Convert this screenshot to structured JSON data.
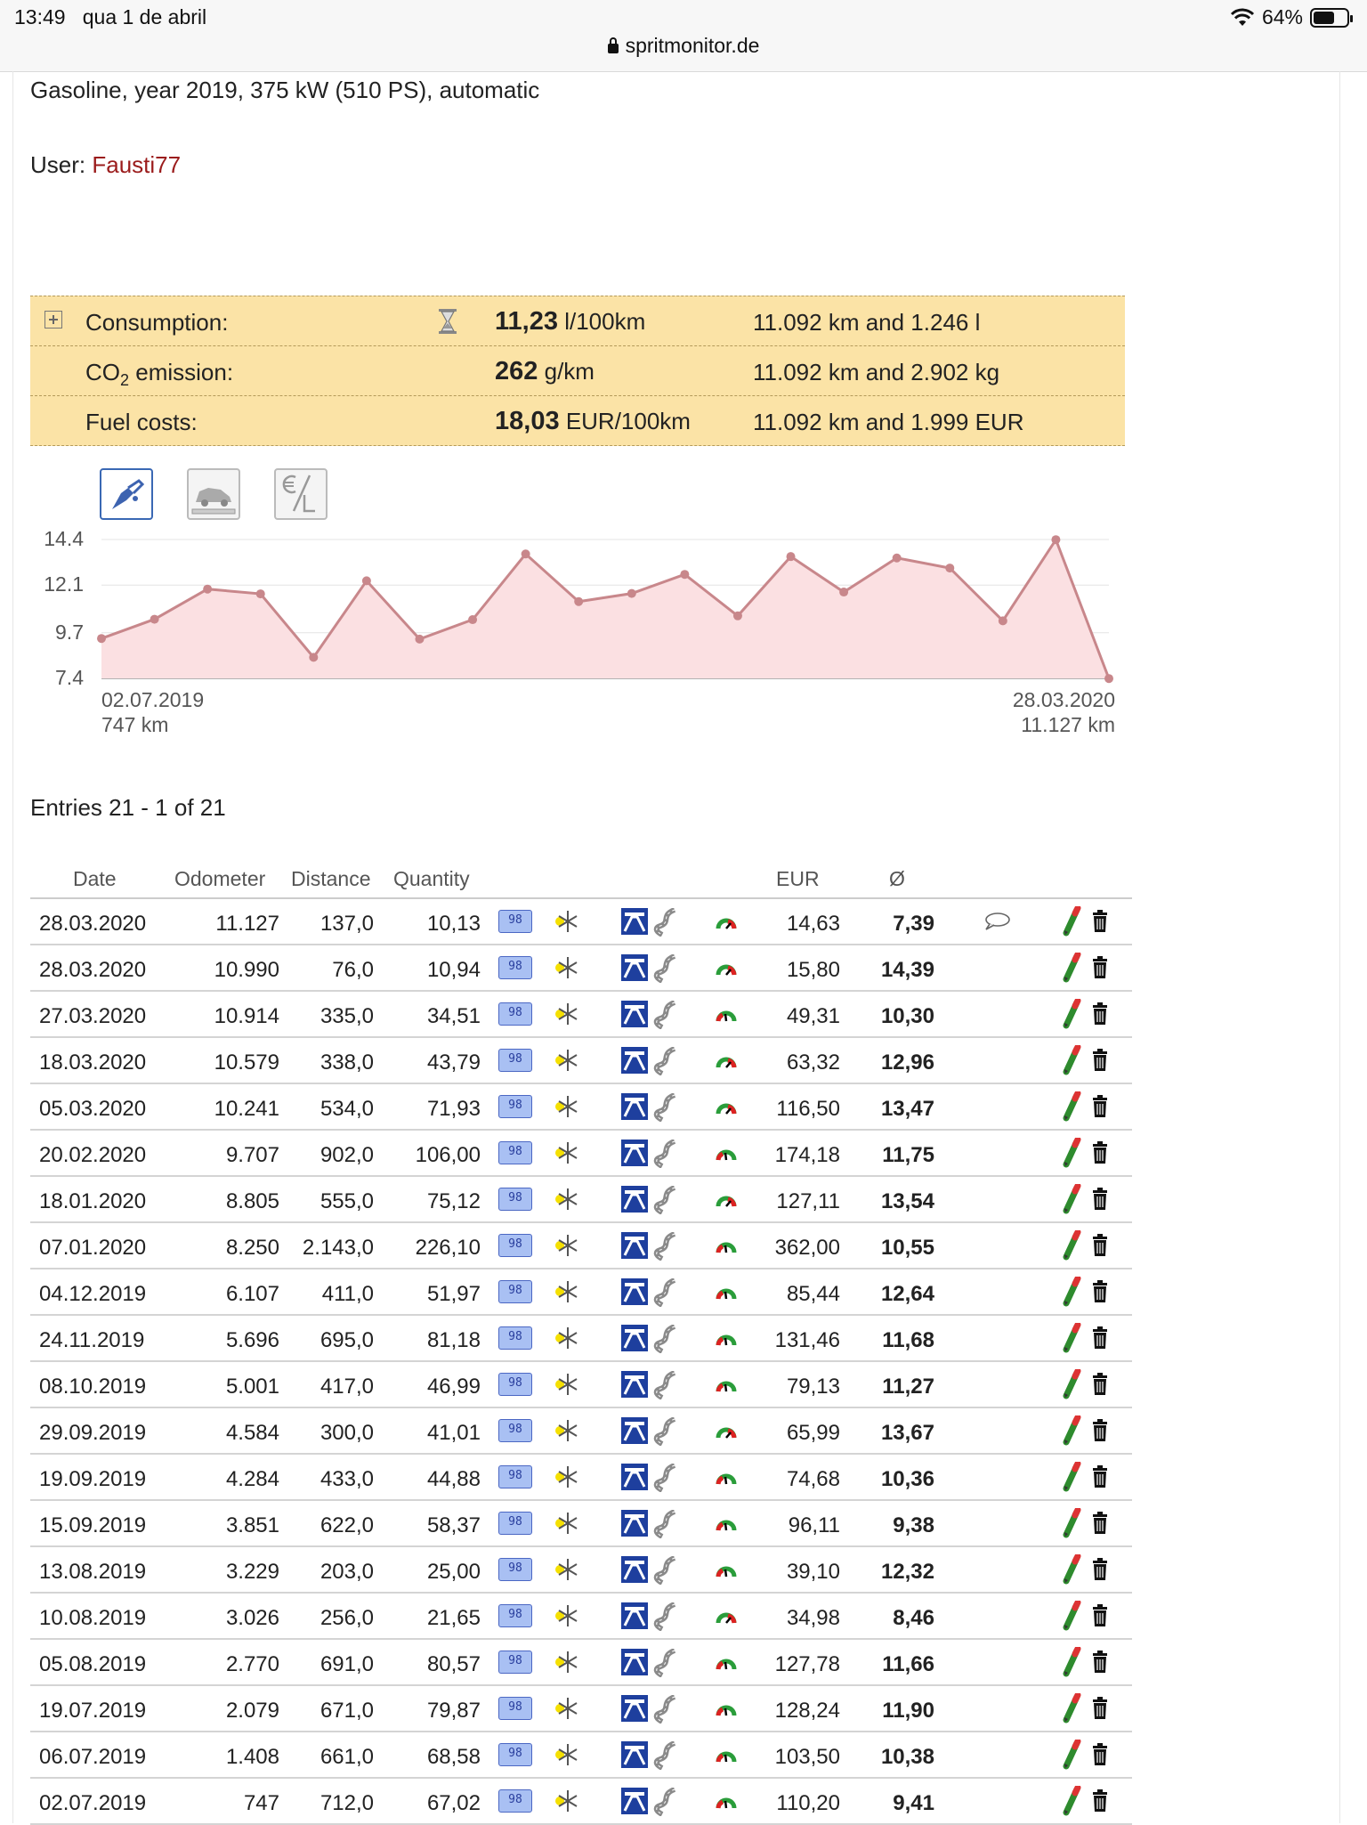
{
  "status": {
    "time": "13:49",
    "date": "qua 1 de abril",
    "battery": "64%",
    "battery_level": 0.64,
    "url": "spritmonitor.de"
  },
  "car": {
    "description": "Gasoline, year 2019, 375 kW (510 PS), automatic"
  },
  "user": {
    "label": "User:",
    "name": "Fausti77"
  },
  "summary": {
    "consumption": {
      "label": "Consumption:",
      "value": "11,23",
      "unit": "l/100km",
      "info": "11.092 km and 1.246 l"
    },
    "co2": {
      "label": "CO",
      "sub": "2",
      "label_rest": " emission:",
      "value": "262",
      "unit": "g/km",
      "info": "11.092 km and 2.902 kg"
    },
    "costs": {
      "label": "Fuel costs:",
      "value": "18,03",
      "unit": "EUR/100km",
      "info": "11.092 km and 1.999 EUR"
    }
  },
  "chart_tabs": [
    "fuel-pump-icon",
    "car-distance-icon",
    "euro-per-liter-icon"
  ],
  "chart_data": {
    "type": "area",
    "ylim": [
      7.4,
      14.4
    ],
    "yticks": [
      "14.4",
      "12.1",
      "9.7",
      "7.4"
    ],
    "x_start": {
      "date": "02.07.2019",
      "km": "747 km"
    },
    "x_end": {
      "date": "28.03.2020",
      "km": "11.127 km"
    },
    "values": [
      9.41,
      10.38,
      11.9,
      11.66,
      8.46,
      12.32,
      9.38,
      10.36,
      13.67,
      11.27,
      11.68,
      12.64,
      10.55,
      13.54,
      11.75,
      13.47,
      12.96,
      10.3,
      14.39,
      7.39
    ],
    "line_color": "#c8878b",
    "fill_color": "#fbe0e2"
  },
  "entries": {
    "title": "Entries 21 - 1 of 21"
  },
  "table": {
    "headers": {
      "date": "Date",
      "odometer": "Odometer",
      "distance": "Distance",
      "quantity": "Quantity",
      "eur": "EUR",
      "avg": "Ø"
    },
    "fuel_badge": "98",
    "rows": [
      {
        "date": "28.03.2020",
        "odo": "11.127",
        "dist": "137,0",
        "qty": "10,13",
        "eur": "14,63",
        "avg": "7,39",
        "comment": true,
        "style": "red"
      },
      {
        "date": "28.03.2020",
        "odo": "10.990",
        "dist": "76,0",
        "qty": "10,94",
        "eur": "15,80",
        "avg": "14,39",
        "comment": false,
        "style": "red"
      },
      {
        "date": "27.03.2020",
        "odo": "10.914",
        "dist": "335,0",
        "qty": "34,51",
        "eur": "49,31",
        "avg": "10,30",
        "comment": false,
        "style": "green"
      },
      {
        "date": "18.03.2020",
        "odo": "10.579",
        "dist": "338,0",
        "qty": "43,79",
        "eur": "63,32",
        "avg": "12,96",
        "comment": false,
        "style": "red"
      },
      {
        "date": "05.03.2020",
        "odo": "10.241",
        "dist": "534,0",
        "qty": "71,93",
        "eur": "116,50",
        "avg": "13,47",
        "comment": false,
        "style": "red"
      },
      {
        "date": "20.02.2020",
        "odo": "9.707",
        "dist": "902,0",
        "qty": "106,00",
        "eur": "174,18",
        "avg": "11,75",
        "comment": false,
        "style": "green"
      },
      {
        "date": "18.01.2020",
        "odo": "8.805",
        "dist": "555,0",
        "qty": "75,12",
        "eur": "127,11",
        "avg": "13,54",
        "comment": false,
        "style": "red"
      },
      {
        "date": "07.01.2020",
        "odo": "8.250",
        "dist": "2.143,0",
        "qty": "226,10",
        "eur": "362,00",
        "avg": "10,55",
        "comment": false,
        "style": "green"
      },
      {
        "date": "04.12.2019",
        "odo": "6.107",
        "dist": "411,0",
        "qty": "51,97",
        "eur": "85,44",
        "avg": "12,64",
        "comment": false,
        "style": "green"
      },
      {
        "date": "24.11.2019",
        "odo": "5.696",
        "dist": "695,0",
        "qty": "81,18",
        "eur": "131,46",
        "avg": "11,68",
        "comment": false,
        "style": "green"
      },
      {
        "date": "08.10.2019",
        "odo": "5.001",
        "dist": "417,0",
        "qty": "46,99",
        "eur": "79,13",
        "avg": "11,27",
        "comment": false,
        "style": "green"
      },
      {
        "date": "29.09.2019",
        "odo": "4.584",
        "dist": "300,0",
        "qty": "41,01",
        "eur": "65,99",
        "avg": "13,67",
        "comment": false,
        "style": "red"
      },
      {
        "date": "19.09.2019",
        "odo": "4.284",
        "dist": "433,0",
        "qty": "44,88",
        "eur": "74,68",
        "avg": "10,36",
        "comment": false,
        "style": "green"
      },
      {
        "date": "15.09.2019",
        "odo": "3.851",
        "dist": "622,0",
        "qty": "58,37",
        "eur": "96,11",
        "avg": "9,38",
        "comment": false,
        "style": "green"
      },
      {
        "date": "13.08.2019",
        "odo": "3.229",
        "dist": "203,0",
        "qty": "25,00",
        "eur": "39,10",
        "avg": "12,32",
        "comment": false,
        "style": "green"
      },
      {
        "date": "10.08.2019",
        "odo": "3.026",
        "dist": "256,0",
        "qty": "21,65",
        "eur": "34,98",
        "avg": "8,46",
        "comment": false,
        "style": "red"
      },
      {
        "date": "05.08.2019",
        "odo": "2.770",
        "dist": "691,0",
        "qty": "80,57",
        "eur": "127,78",
        "avg": "11,66",
        "comment": false,
        "style": "green"
      },
      {
        "date": "19.07.2019",
        "odo": "2.079",
        "dist": "671,0",
        "qty": "79,87",
        "eur": "128,24",
        "avg": "11,90",
        "comment": false,
        "style": "green"
      },
      {
        "date": "06.07.2019",
        "odo": "1.408",
        "dist": "661,0",
        "qty": "68,58",
        "eur": "103,50",
        "avg": "10,38",
        "comment": false,
        "style": "green"
      },
      {
        "date": "02.07.2019",
        "odo": "747",
        "dist": "712,0",
        "qty": "67,02",
        "eur": "110,20",
        "avg": "9,41",
        "comment": false,
        "style": "green"
      }
    ]
  }
}
